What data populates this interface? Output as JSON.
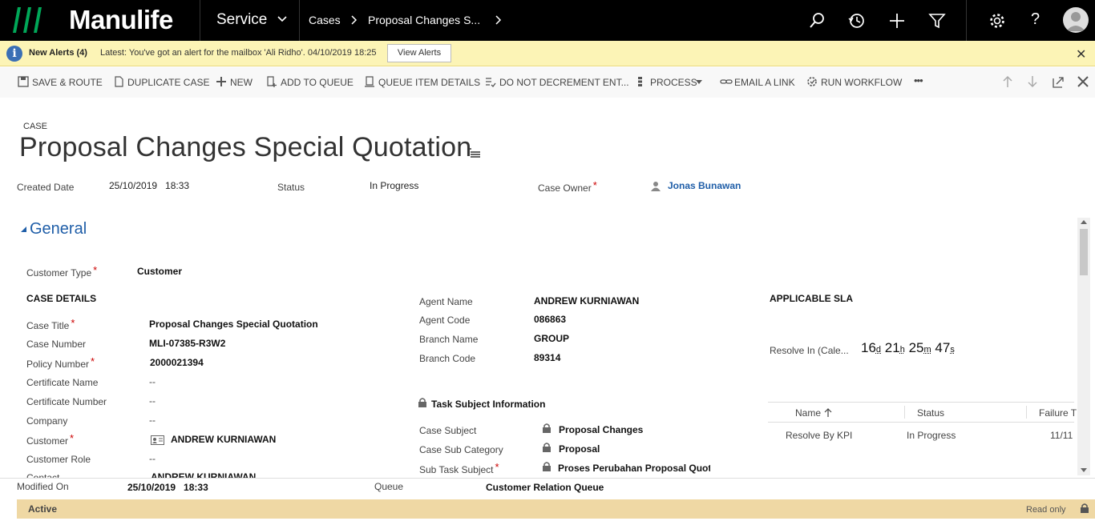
{
  "app": {
    "brand": "Manulife",
    "brand_color": "#00a758",
    "module": "Service",
    "breadcrumb": [
      "Cases",
      "Proposal Changes S..."
    ]
  },
  "topbar_icons": [
    "search-icon",
    "history-icon",
    "plus-icon",
    "filter-icon",
    "gear-icon",
    "help-icon",
    "avatar"
  ],
  "alert": {
    "title": "New Alerts (4)",
    "message": "Latest: You've got an alert for the mailbox 'Ali Ridho'. 04/10/2019 18:25",
    "button": "View Alerts"
  },
  "commands": {
    "save_route": "SAVE & ROUTE",
    "duplicate": "DUPLICATE CASE",
    "new": "NEW",
    "add_queue": "ADD TO QUEUE",
    "queue_details": "QUEUE ITEM DETAILS",
    "do_not_decrement": "DO NOT DECREMENT ENT...",
    "process": "PROCESS",
    "email_link": "EMAIL A LINK",
    "run_workflow": "RUN WORKFLOW",
    "more": "•••"
  },
  "record": {
    "entity": "CASE",
    "title": "Proposal Changes Special Quotation"
  },
  "header_fields": {
    "created_label": "Created Date",
    "created_value": "25/10/2019   18:33",
    "status_label": "Status",
    "status_value": "In Progress",
    "owner_label": "Case Owner",
    "owner_value": "Jonas Bunawan"
  },
  "general": {
    "title": "General",
    "customer_type_label": "Customer Type",
    "customer_type_value": "Customer",
    "case_details_heading": "CASE DETAILS",
    "case_title_label": "Case Title",
    "case_title_value": "Proposal Changes Special Quotation",
    "case_number_label": "Case Number",
    "case_number_value": "MLI-07385-R3W2",
    "policy_label": "Policy Number",
    "policy_value": "2000021394",
    "cert_name_label": "Certificate Name",
    "cert_name_value": "--",
    "cert_number_label": "Certificate Number",
    "cert_number_value": "--",
    "company_label": "Company",
    "company_value": "--",
    "customer_label": "Customer",
    "customer_value": "ANDREW KURNIAWAN",
    "customer_role_label": "Customer Role",
    "customer_role_value": "--",
    "contact_label": "Contact",
    "contact_value": "ANDREW KURNIAWAN",
    "agent_name_label": "Agent Name",
    "agent_name_value": "ANDREW KURNIAWAN",
    "agent_code_label": "Agent Code",
    "agent_code_value": "086863",
    "branch_name_label": "Branch Name",
    "branch_name_value": "GROUP",
    "branch_code_label": "Branch Code",
    "branch_code_value": "89314",
    "task_heading": "Task Subject Information",
    "case_subject_label": "Case Subject",
    "case_subject_value": "Proposal Changes",
    "case_sub_cat_label": "Case Sub Category",
    "case_sub_cat_value": "Proposal",
    "sub_task_label": "Sub Task Subject",
    "sub_task_value": "Proses Perubahan Proposal Quot",
    "sla_heading": "APPLICABLE SLA",
    "resolve_label": "Resolve In (Cale...",
    "timer": {
      "d": "16",
      "h": "21",
      "m": "25",
      "s": "47",
      "d_u": "d",
      "h_u": "h",
      "m_u": "m",
      "s_u": "s"
    },
    "sla_cols": [
      "Name",
      "Status",
      "Failure T"
    ],
    "sla_rows": [
      {
        "name": "Resolve By KPI",
        "status": "In Progress",
        "failure": "11/11"
      }
    ]
  },
  "footer": {
    "modified_label": "Modified On",
    "modified_value": "25/10/2019   18:33",
    "queue_label": "Queue",
    "queue_value": "Customer Relation Queue",
    "status": "Active",
    "readonly": "Read only"
  }
}
